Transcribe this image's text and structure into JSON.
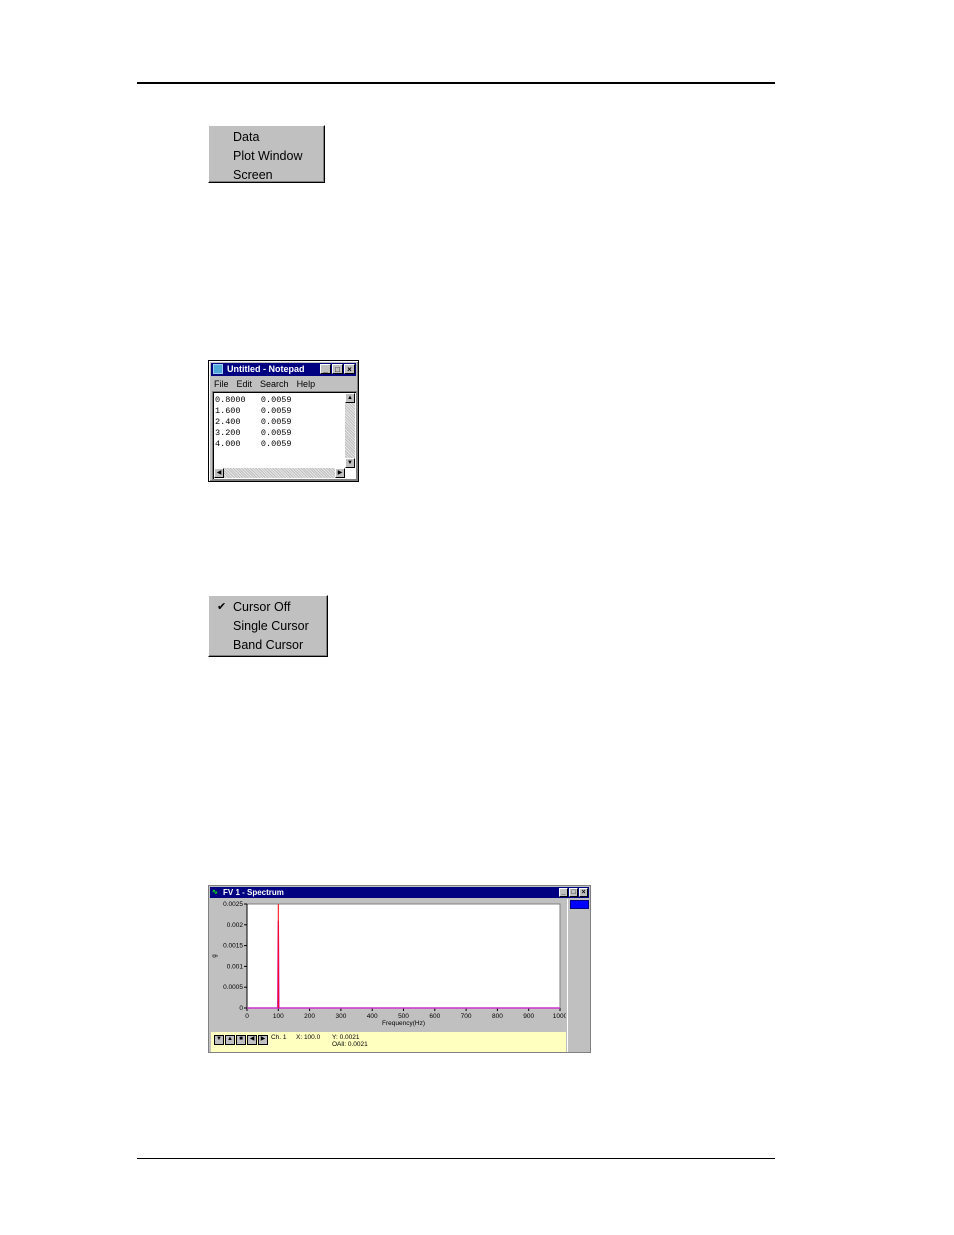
{
  "menus": {
    "export": {
      "items": [
        "Data",
        "Plot Window",
        "Screen"
      ]
    },
    "cursor": {
      "items": [
        {
          "label": "Cursor Off",
          "checked": true
        },
        {
          "label": "Single Cursor",
          "checked": false
        },
        {
          "label": "Band Cursor",
          "checked": false
        }
      ]
    }
  },
  "notepad": {
    "title": "Untitled - Notepad",
    "menu": [
      "File",
      "Edit",
      "Search",
      "Help"
    ],
    "lines": [
      "0.8000   0.0059",
      "1.600    0.0059",
      "2.400    0.0059",
      "3.200    0.0059",
      "4.000    0.0059"
    ],
    "buttons": {
      "minimize": "_",
      "maximize": "□",
      "close": "×"
    }
  },
  "spectrum": {
    "title": "FV 1 - Spectrum",
    "buttons": {
      "minimize": "_",
      "maximize": "□",
      "close": "×"
    },
    "nav": [
      "▼",
      "▲",
      "■",
      "◀",
      "▶"
    ],
    "status": {
      "channel": "Ch. 1",
      "x": "X: 100.0",
      "y": "Y: 0.0021",
      "oall": "OAll: 0.0021"
    },
    "colors": {
      "series": "#cc33cc",
      "cursor": "#ff0000",
      "swatch": "#0000ff"
    }
  },
  "chart_data": {
    "type": "line",
    "title": "",
    "xlabel": "Frequency(Hz)",
    "ylabel": "g",
    "xlim": [
      0,
      1000
    ],
    "ylim": [
      0,
      0.0025
    ],
    "xticks": [
      0,
      100,
      200,
      300,
      400,
      500,
      600,
      700,
      800,
      900,
      1000
    ],
    "yticks": [
      0,
      0.0005,
      0.001,
      0.0015,
      0.002,
      0.0025
    ],
    "ytick_labels": [
      "0",
      "0.0005",
      "0.001",
      "0.0015",
      "0.002",
      "0.0025"
    ],
    "series": [
      {
        "x": [
          0,
          98,
          100,
          102,
          1000
        ],
        "y": [
          0,
          0,
          0.0021,
          0,
          0
        ]
      }
    ],
    "cursor_x": 100,
    "grid": false
  }
}
